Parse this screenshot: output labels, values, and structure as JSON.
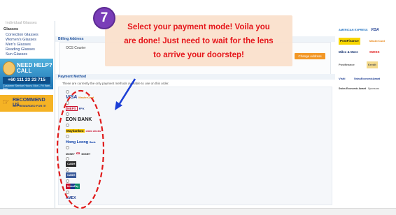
{
  "sidebar": {
    "partial_top": "Individual Glasses",
    "category_title": "Glasses",
    "items": [
      "Correction Glasses",
      "Women's Glasses",
      "Men's Glasses",
      "Reading Glasses",
      "Sun Glasses"
    ],
    "help_title_1": "NEED HELP?",
    "help_title_2": "CALL",
    "help_phone": "+60 111 23 23 715",
    "help_hours": "Customer Service Hours: Mon - Fri 9am - 6pm",
    "recommend_title": "RECOMMEND US",
    "recommend_sub": "GET REWARDED FOR IT!"
  },
  "main": {
    "billing_title": "Billing Address",
    "billing_name": "OCS Courier",
    "change_address": "Change Address",
    "payment_title": "Payment Method",
    "payment_note": "These are currently the only payment methods available to use on this order.",
    "payment_options": [
      {
        "label": "VISA",
        "label2": "MasterCard",
        "color": "#1a3a8f"
      },
      {
        "label": "MEPS",
        "label2": "FPX",
        "color": "#c8102e"
      },
      {
        "label": "EON BANK",
        "label2": "",
        "color": "#1a1a1a"
      },
      {
        "label": "Maybank2u",
        "label2": "cimb clicks",
        "color": "#7a5a00"
      },
      {
        "label": "Hong Leong",
        "label2": "Bank",
        "color": "#0b3fa8"
      },
      {
        "label": "MONEY",
        "label2": "MONEY",
        "color": "#c8102e"
      },
      {
        "label": "CASH",
        "label2": "",
        "color": "#222"
      },
      {
        "label": "CASH",
        "label2": "",
        "color": "#222"
      },
      {
        "label": "UnionPay",
        "label2": "",
        "color": "#c8102e"
      },
      {
        "label": "AMEX",
        "label2": "",
        "color": "#1a3a8f"
      }
    ]
  },
  "ads": {
    "row1": [
      "AMERICAN EXPRESS",
      "VISA"
    ],
    "row2": [
      "PostFinance",
      "MasterCard"
    ],
    "row3": [
      "Miles & More",
      "SWISS"
    ],
    "row4": [
      "Postfinance",
      "Kredit"
    ],
    "row5": [
      "Visiti",
      "SwissEconomicAward"
    ],
    "row6": [
      "Swiss Economic Award",
      "Sponsors"
    ]
  },
  "overlay": {
    "step_number": "7",
    "callout_line1": "Select your payment mode! Voila you",
    "callout_line2": "are done! Just need to wait for the lens",
    "callout_line3": "to arrive your doorstep!"
  },
  "colors": {
    "callout_bg": "#fae0cc",
    "callout_text": "#e5161b",
    "badge_bg": "#7a3db8",
    "annotation_red": "#e01b1b",
    "arrow_blue": "#1c3fd6",
    "button_orange": "#f29726"
  }
}
